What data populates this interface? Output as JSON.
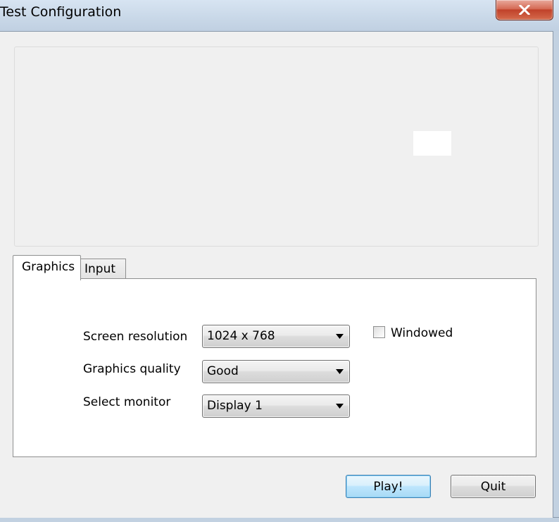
{
  "window": {
    "title": "Test Configuration",
    "close_icon": "close-icon"
  },
  "tabs": [
    {
      "label": "Graphics",
      "selected": true
    },
    {
      "label": "Input",
      "selected": false
    }
  ],
  "graphics": {
    "resolution_label": "Screen resolution",
    "resolution_value": "1024 x 768",
    "quality_label": "Graphics quality",
    "quality_value": "Good",
    "monitor_label": "Select monitor",
    "monitor_value": "Display 1",
    "windowed_label": "Windowed",
    "windowed_checked": false
  },
  "buttons": {
    "play": "Play!",
    "quit": "Quit"
  }
}
